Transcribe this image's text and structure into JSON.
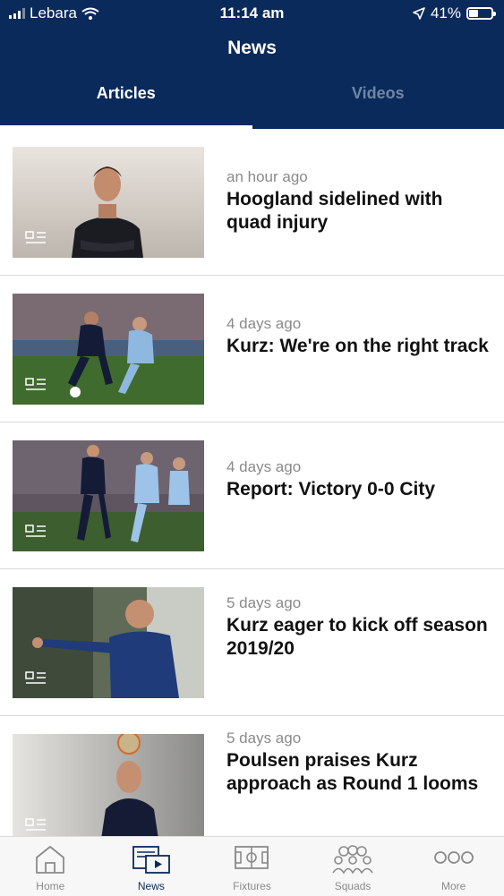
{
  "status_bar": {
    "carrier": "Lebara",
    "time": "11:14 am",
    "battery": "41%",
    "battery_level": 0.41
  },
  "header": {
    "title": "News"
  },
  "tabs": [
    {
      "label": "Articles",
      "active": true
    },
    {
      "label": "Videos",
      "active": false
    }
  ],
  "articles": [
    {
      "time": "an hour ago",
      "title": "Hoogland sidelined with quad injury",
      "thumb_icon": "article-icon"
    },
    {
      "time": "4 days ago",
      "title": "Kurz: We're on the right track",
      "thumb_icon": "article-icon"
    },
    {
      "time": "4 days ago",
      "title": "Report: Victory 0-0 City",
      "thumb_icon": "article-icon"
    },
    {
      "time": "5 days ago",
      "title": "Kurz eager to kick off season 2019/20",
      "thumb_icon": "article-icon"
    },
    {
      "time": "5 days ago",
      "title": "Poulsen praises Kurz approach as Round 1 looms",
      "thumb_icon": "article-icon"
    }
  ],
  "tabbar": [
    {
      "label": "Home",
      "icon": "home-icon",
      "active": false
    },
    {
      "label": "News",
      "icon": "news-icon",
      "active": true
    },
    {
      "label": "Fixtures",
      "icon": "pitch-icon",
      "active": false
    },
    {
      "label": "Squads",
      "icon": "squad-icon",
      "active": false
    },
    {
      "label": "More",
      "icon": "more-icon",
      "active": false
    }
  ],
  "colors": {
    "navy": "#0a2a5b",
    "inactive_tab": "#6f86a6",
    "muted_text": "#8a8a8a"
  }
}
